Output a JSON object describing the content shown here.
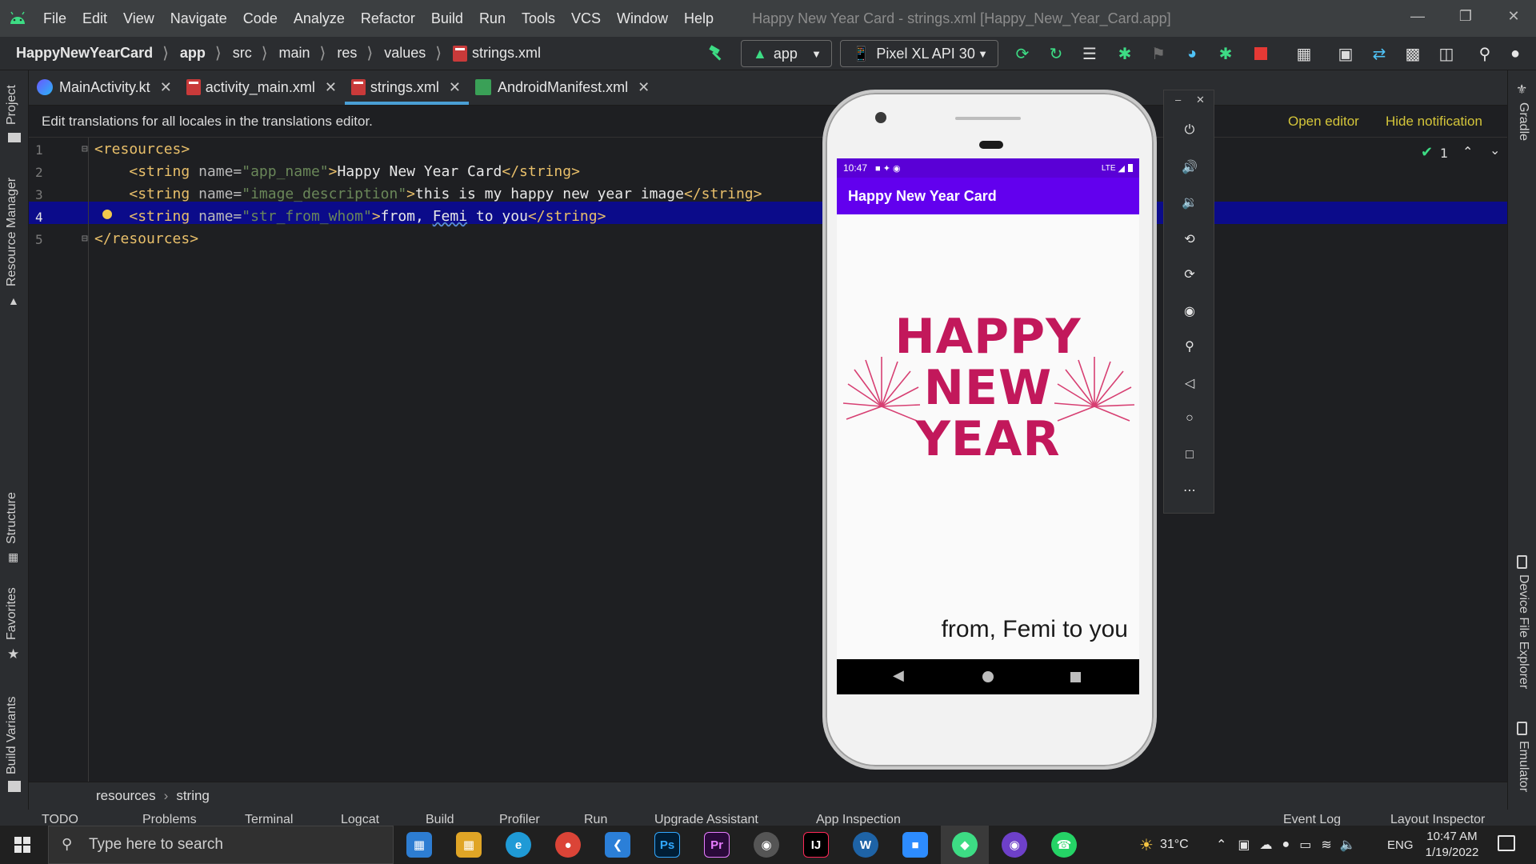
{
  "menu": {
    "items": [
      "File",
      "Edit",
      "View",
      "Navigate",
      "Code",
      "Analyze",
      "Refactor",
      "Build",
      "Run",
      "Tools",
      "VCS",
      "Window",
      "Help"
    ],
    "window_title": "Happy New Year Card - strings.xml [Happy_New_Year_Card.app]"
  },
  "breadcrumb": {
    "project": "HappyNewYearCard",
    "parts": [
      "app",
      "src",
      "main",
      "res",
      "values",
      "strings.xml"
    ]
  },
  "toolbar": {
    "module": "app",
    "device": "Pixel XL API 30"
  },
  "tabs": [
    {
      "label": "MainActivity.kt"
    },
    {
      "label": "activity_main.xml"
    },
    {
      "label": "strings.xml"
    },
    {
      "label": "AndroidManifest.xml"
    }
  ],
  "notification": {
    "message": "Edit translations for all locales in the translations editor.",
    "open_editor": "Open editor",
    "hide": "Hide notification"
  },
  "inspection": {
    "count": "1"
  },
  "editor": {
    "line_numbers": [
      "1",
      "2",
      "3",
      "4",
      "5"
    ],
    "lines": {
      "l1_open": "<resources>",
      "l2_tag_open": "<string ",
      "l2_attr": "name=",
      "l2_val": "\"app_name\"",
      "l2_gt": ">",
      "l2_text": "Happy New Year Card",
      "l2_close": "</string>",
      "l3_tag_open": "<string ",
      "l3_attr": "name=",
      "l3_val": "\"image_description\"",
      "l3_gt": ">",
      "l3_text": "this is my happy new year image",
      "l3_close": "</string>",
      "l4_tag_open": "<string ",
      "l4_attr": "name=",
      "l4_val": "\"str_from_whom\"",
      "l4_gt": ">",
      "l4_text_a": "from, ",
      "l4_text_b": "Femi",
      "l4_text_c": " to you",
      "l4_close": "</string>",
      "l5_close": "</resources>"
    }
  },
  "bottom_breadcrumb": [
    "resources",
    "string"
  ],
  "side_tools_left": [
    "Project",
    "Resource Manager",
    "Structure",
    "Favorites",
    "Build Variants"
  ],
  "side_tools_right": [
    "Gradle",
    "Device File Explorer",
    "Emulator"
  ],
  "bottom_tools": [
    "TODO",
    "Problems",
    "Terminal",
    "Logcat",
    "Build",
    "Profiler",
    "Run",
    "Upgrade Assistant",
    "App Inspection",
    "Event Log",
    "Layout Inspector"
  ],
  "phone": {
    "status_time": "10:47",
    "status_net": "LTE",
    "app_title": "Happy New Year Card",
    "card_line1": "HAPPY",
    "card_line2": "NEW",
    "card_line3": "YEAR",
    "from_text": "from, Femi to you"
  },
  "taskbar": {
    "search_placeholder": "Type here to search",
    "weather": "31°C",
    "lang": "ENG",
    "time": "10:47 AM",
    "date": "1/19/2022"
  }
}
